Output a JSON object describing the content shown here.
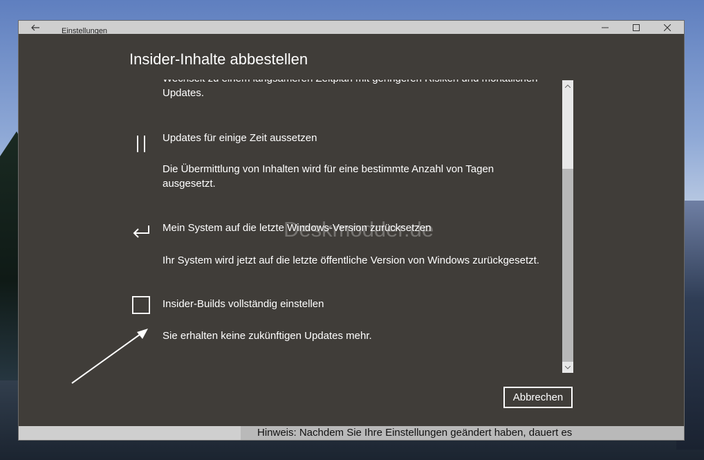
{
  "window": {
    "title": "Einstellungen"
  },
  "dialog": {
    "title": "Insider-Inhalte abbestellen",
    "options": [
      {
        "icon": "none",
        "title": "",
        "description": "Wechselt zu einem langsameren Zeitplan mit geringeren Risiken und monatlichen Updates."
      },
      {
        "icon": "pause-icon",
        "title": "Updates für einige Zeit aussetzen",
        "description": "Die Übermittlung von Inhalten wird für eine bestimmte Anzahl von Tagen ausgesetzt."
      },
      {
        "icon": "return-arrow-icon",
        "title": "Mein System auf die letzte Windows-Version zurücksetzen",
        "description": "Ihr System wird jetzt auf die letzte öffentliche Version von Windows zurückgesetzt."
      },
      {
        "icon": "stop-square-icon",
        "title": "Insider-Builds vollständig einstellen",
        "description": "Sie erhalten keine zukünftigen Updates mehr."
      }
    ],
    "cancel_label": "Abbrechen"
  },
  "footer": {
    "note": "Hinweis: Nachdem Sie Ihre Einstellungen geändert haben, dauert es"
  },
  "watermark": "Deskmodder.de",
  "colors": {
    "dialog_bg": "#403d39",
    "text": "#ffffff",
    "titlebar": "#cfcfcf",
    "scrollbar": "#b8b8b8"
  }
}
